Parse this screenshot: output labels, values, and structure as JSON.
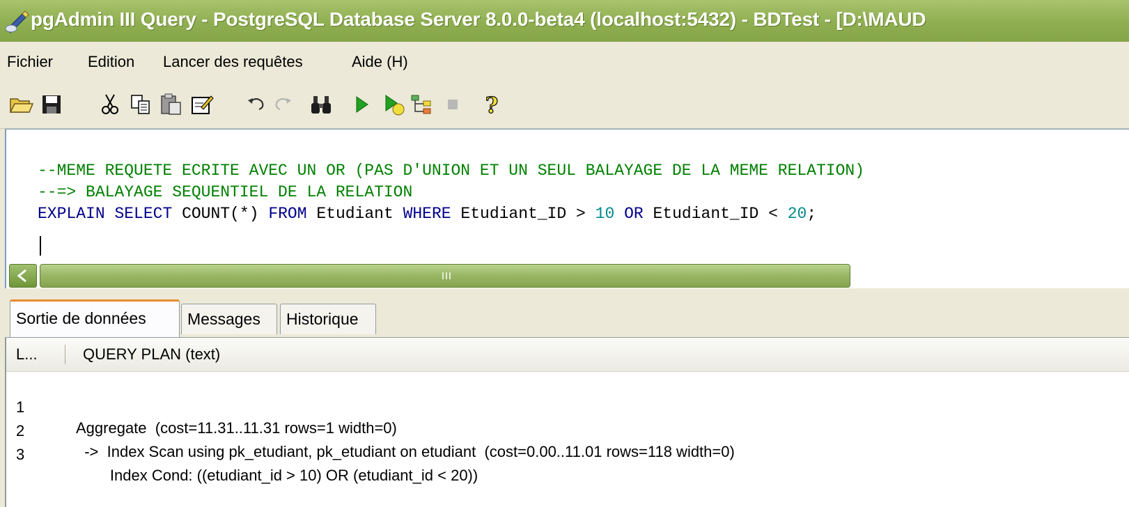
{
  "window": {
    "title": "pgAdmin III Query - PostgreSQL Database Server 8.0.0-beta4 (localhost:5432) - BDTest - [D:\\MAUD",
    "app_icon": "pgadmin-elephant-icon"
  },
  "menu": {
    "items": [
      {
        "label": "Fichier"
      },
      {
        "label": "Edition"
      },
      {
        "label": "Lancer des requêtes"
      },
      {
        "label": "Aide (H)"
      }
    ]
  },
  "toolbar": {
    "buttons": [
      {
        "name": "open",
        "icon": "open-folder-icon"
      },
      {
        "name": "save",
        "icon": "save-disk-icon"
      },
      {
        "name": "cut",
        "icon": "cut-scissors-icon"
      },
      {
        "name": "copy",
        "icon": "copy-icon"
      },
      {
        "name": "paste",
        "icon": "paste-icon"
      },
      {
        "name": "clear",
        "icon": "clear-edit-icon"
      },
      {
        "name": "undo",
        "icon": "undo-icon"
      },
      {
        "name": "redo",
        "icon": "redo-icon"
      },
      {
        "name": "find",
        "icon": "binoculars-icon"
      },
      {
        "name": "execute",
        "icon": "play-icon"
      },
      {
        "name": "execute-to-file",
        "icon": "play-file-icon"
      },
      {
        "name": "explain",
        "icon": "explain-icon"
      },
      {
        "name": "cancel",
        "icon": "stop-icon"
      },
      {
        "name": "help",
        "icon": "help-question-icon"
      }
    ]
  },
  "editor": {
    "line1": "--MEME REQUETE ECRITE AVEC UN OR (PAS D'UNION ET UN SEUL BALAYAGE DE LA MEME RELATION)",
    "line2": "--=> BALAYAGE SEQUENTIEL DE LA RELATION",
    "line3": {
      "kw_explain": "EXPLAIN",
      "kw_select": "SELECT",
      "count": "COUNT(*)",
      "kw_from": "FROM",
      "table": "Etudiant",
      "kw_where": "WHERE",
      "col1": "Etudiant_ID >",
      "num1": "10",
      "kw_or": "OR",
      "col2": "Etudiant_ID <",
      "num2": "20",
      "end": ";"
    }
  },
  "tabs": [
    {
      "label": "Sortie de données",
      "active": true
    },
    {
      "label": "Messages",
      "active": false
    },
    {
      "label": "Historique",
      "active": false
    }
  ],
  "results": {
    "columns": [
      "L...",
      "QUERY PLAN (text)"
    ],
    "rows": [
      {
        "num": "1",
        "plan": "Aggregate  (cost=11.31..11.31 rows=1 width=0)"
      },
      {
        "num": "2",
        "plan": "  ->  Index Scan using pk_etudiant, pk_etudiant on etudiant  (cost=0.00..11.01 rows=118 width=0)"
      },
      {
        "num": "3",
        "plan": "        Index Cond: ((etudiant_id > 10) OR (etudiant_id < 20))"
      }
    ]
  },
  "colors": {
    "titlebar": "#8fae51",
    "comment": "#008000",
    "keyword": "#00008b",
    "number": "#008b8b",
    "active_tab_accent": "#e68b2c"
  }
}
